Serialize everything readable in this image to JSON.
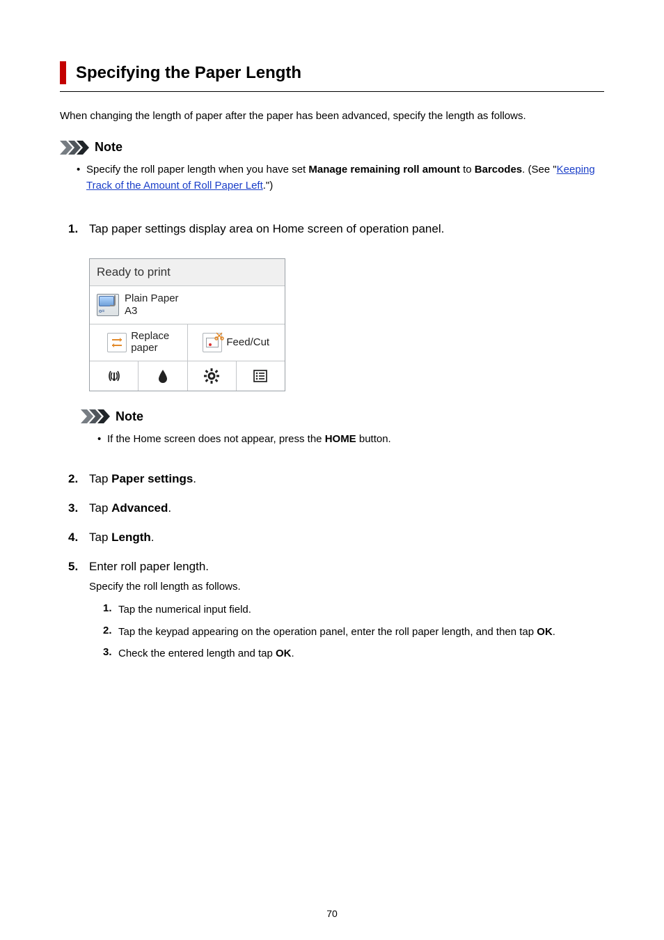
{
  "page": {
    "title": "Specifying the Paper Length",
    "intro": "When changing the length of paper after the paper has been advanced, specify the length as follows.",
    "pageNumber": "70"
  },
  "noteTop": {
    "label": "Note",
    "bullet": {
      "pre": "Specify the roll paper length when you have set ",
      "b1": "Manage remaining roll amount",
      "mid": " to ",
      "b2": "Barcodes",
      "post": ". (See \"",
      "link": "Keeping Track of the Amount of Roll Paper Left",
      "tail": ".\")"
    }
  },
  "step1": {
    "num": "1.",
    "text": "Tap paper settings display area on Home screen of operation panel."
  },
  "screenshot": {
    "status": "Ready to print",
    "paper": {
      "line1": "Plain Paper",
      "line2": "A3"
    },
    "replace": {
      "line1": "Replace",
      "line2": "paper"
    },
    "feedcut": "Feed/Cut",
    "icons": {
      "wireless": "wireless-icon",
      "ink": "ink-icon",
      "settings": "settings-icon",
      "jobs": "jobs-icon"
    }
  },
  "noteInner": {
    "label": "Note",
    "bullet": {
      "pre": "If the Home screen does not appear, press the ",
      "b1": "HOME",
      "post": " button."
    }
  },
  "step2": {
    "num": "2.",
    "pre": "Tap ",
    "b": "Paper settings",
    "post": "."
  },
  "step3": {
    "num": "3.",
    "pre": "Tap ",
    "b": "Advanced",
    "post": "."
  },
  "step4": {
    "num": "4.",
    "pre": "Tap ",
    "b": "Length",
    "post": "."
  },
  "step5": {
    "num": "5.",
    "text": "Enter roll paper length.",
    "desc": "Specify the roll length as follows.",
    "subs": [
      {
        "n": "1.",
        "t": "Tap the numerical input field."
      },
      {
        "n": "2.",
        "pre": "Tap the keypad appearing on the operation panel, enter the roll paper length, and then tap ",
        "b": "OK",
        "post": "."
      },
      {
        "n": "3.",
        "pre": "Check the entered length and tap ",
        "b": "OK",
        "post": "."
      }
    ]
  }
}
